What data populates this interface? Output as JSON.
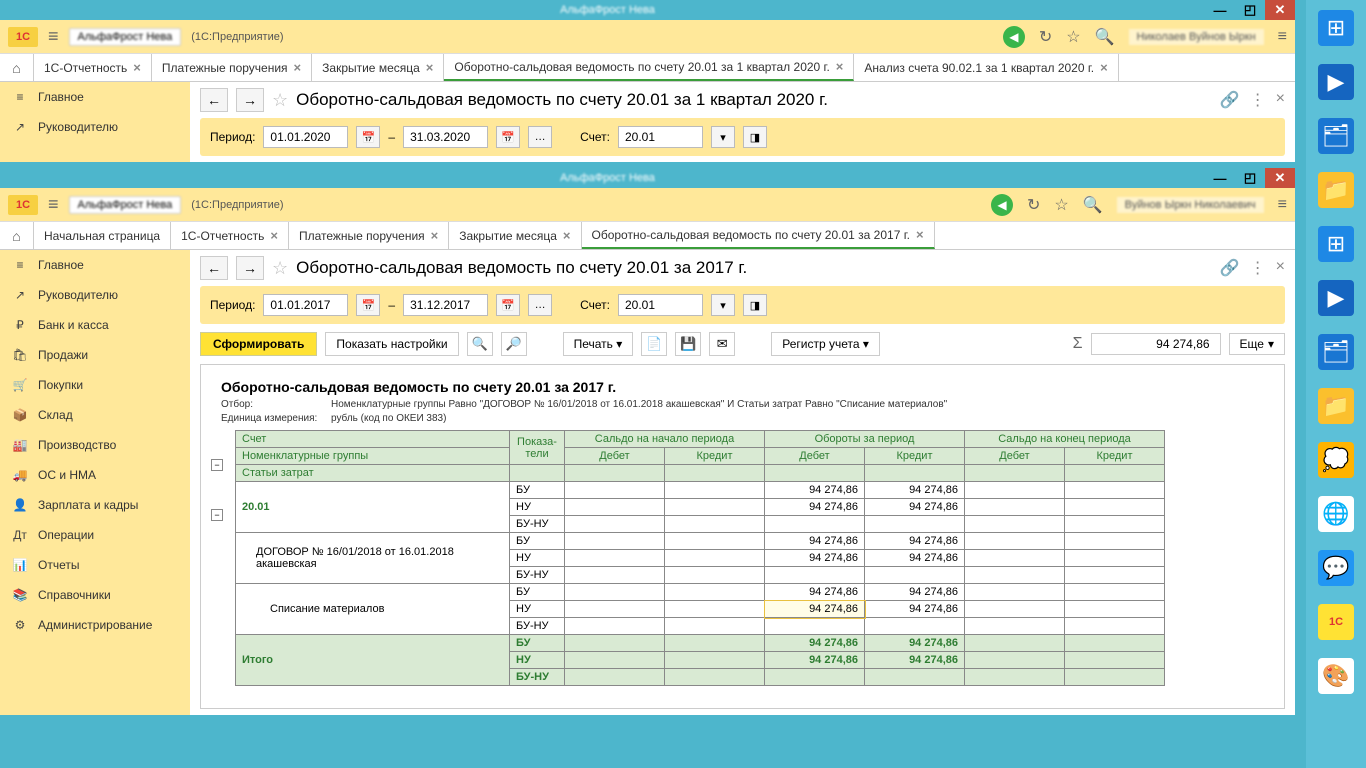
{
  "window1": {
    "titlebar": "АльфаФрост Нева",
    "orgname": "АльфаФрост Нева",
    "appmode": "(1С:Предприятие)",
    "user": "Николаев Вуйнов Ыркн",
    "tabs": [
      {
        "label": "1С-Отчетность"
      },
      {
        "label": "Платежные поручения"
      },
      {
        "label": "Закрытие месяца"
      },
      {
        "label": "Оборотно-сальдовая ведомость по счету 20.01 за 1 квартал 2020 г.",
        "active": true
      },
      {
        "label": "Анализ счета 90.02.1 за 1 квартал 2020 г."
      }
    ],
    "sidebar": [
      {
        "icon": "≡",
        "label": "Главное"
      },
      {
        "icon": "↗",
        "label": "Руководителю"
      }
    ],
    "page_title": "Оборотно-сальдовая ведомость по счету 20.01 за 1 квартал 2020 г.",
    "period_label": "Период:",
    "date_from": "01.01.2020",
    "date_to": "31.03.2020",
    "acct_label": "Счет:",
    "acct_value": "20.01"
  },
  "window2": {
    "titlebar": "АльфаФрост Нева",
    "orgname": "АльфаФрост Нева",
    "appmode": "(1С:Предприятие)",
    "user": "Вуйнов Ыркн Николаевич",
    "tabs": [
      {
        "label": "Начальная страница",
        "home": true
      },
      {
        "label": "1С-Отчетность"
      },
      {
        "label": "Платежные поручения"
      },
      {
        "label": "Закрытие месяца"
      },
      {
        "label": "Оборотно-сальдовая ведомость по счету 20.01 за 2017 г.",
        "active": true
      }
    ],
    "sidebar": [
      {
        "icon": "≡",
        "label": "Главное"
      },
      {
        "icon": "↗",
        "label": "Руководителю"
      },
      {
        "icon": "₽",
        "label": "Банк и касса"
      },
      {
        "icon": "🛍",
        "label": "Продажи"
      },
      {
        "icon": "🛒",
        "label": "Покупки"
      },
      {
        "icon": "📦",
        "label": "Склад"
      },
      {
        "icon": "🏭",
        "label": "Производство"
      },
      {
        "icon": "🚚",
        "label": "ОС и НМА"
      },
      {
        "icon": "👤",
        "label": "Зарплата и кадры"
      },
      {
        "icon": "Дт",
        "label": "Операции"
      },
      {
        "icon": "📊",
        "label": "Отчеты"
      },
      {
        "icon": "📚",
        "label": "Справочники"
      },
      {
        "icon": "⚙",
        "label": "Администрирование"
      }
    ],
    "page_title": "Оборотно-сальдовая ведомость по счету 20.01 за 2017 г.",
    "period_label": "Период:",
    "date_from": "01.01.2017",
    "date_to": "31.12.2017",
    "acct_label": "Счет:",
    "acct_value": "20.01",
    "btn_form": "Сформировать",
    "btn_settings": "Показать настройки",
    "btn_print": "Печать",
    "btn_register": "Регистр учета",
    "sum_value": "94 274,86",
    "more": "Еще",
    "report": {
      "title": "Оборотно-сальдовая ведомость по счету 20.01 за 2017 г.",
      "filter_label": "Отбор:",
      "filter_value": "Номенклатурные группы Равно \"ДОГОВОР  № 16/01/2018 от 16.01.2018 акашевская\" И Статьи затрат Равно \"Списание материалов\"",
      "unit_label": "Единица измерения:",
      "unit_value": "рубль (код по ОКЕИ 383)",
      "headers": {
        "account": "Счет",
        "indicators": "Показа-\nтели",
        "start_balance": "Сальдо на начало периода",
        "turnover": "Обороты за период",
        "end_balance": "Сальдо на конец периода",
        "debit": "Дебет",
        "credit": "Кредит",
        "nomen": "Номенклатурные группы",
        "cost_items": "Статьи затрат"
      },
      "rows": [
        {
          "name": "20.01",
          "class": "acc",
          "ind": [
            "БУ",
            "НУ",
            "БУ-НУ"
          ],
          "dt": [
            "94 274,86",
            "94 274,86",
            ""
          ],
          "kt": [
            "94 274,86",
            "94 274,86",
            ""
          ]
        },
        {
          "name": "ДОГОВОР  № 16/01/2018 от 16.01.2018 акашевская",
          "indent": 1,
          "ind": [
            "БУ",
            "НУ",
            "БУ-НУ"
          ],
          "dt": [
            "94 274,86",
            "94 274,86",
            ""
          ],
          "kt": [
            "94 274,86",
            "94 274,86",
            ""
          ]
        },
        {
          "name": "Списание материалов",
          "indent": 2,
          "ind": [
            "БУ",
            "НУ",
            "БУ-НУ"
          ],
          "dt": [
            "94 274,86",
            "94 274,86",
            ""
          ],
          "kt": [
            "94 274,86",
            "94 274,86",
            ""
          ],
          "hl_row": 1
        }
      ],
      "total_label": "Итого",
      "total": {
        "ind": [
          "БУ",
          "НУ",
          "БУ-НУ"
        ],
        "dt": [
          "94 274,86",
          "94 274,86",
          ""
        ],
        "kt": [
          "94 274,86",
          "94 274,86",
          ""
        ]
      }
    }
  },
  "desktop_icons": [
    "⊞",
    "▶",
    "📁",
    "📂",
    "⊞",
    "▶",
    "📁",
    "📂",
    "💭",
    "🌐",
    "💬",
    "1С",
    "🎨"
  ]
}
